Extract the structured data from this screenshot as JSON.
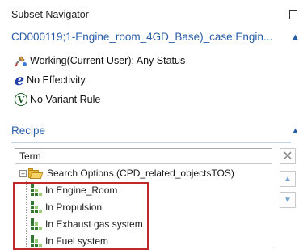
{
  "navigator": {
    "title": "Subset Navigator",
    "context_name": "CD000119;1-Engine_room_4GD_Base)_case:Engin...",
    "status": [
      {
        "icon": "working-status-icon",
        "text": "Working(Current User); Any Status"
      },
      {
        "icon": "effectivity-icon",
        "text": "No Effectivity",
        "glyph": "e"
      },
      {
        "icon": "variant-rule-icon",
        "text": "No Variant Rule",
        "glyph": "V"
      }
    ]
  },
  "recipe": {
    "title": "Recipe",
    "column_header": "Term",
    "rows": [
      {
        "label": "Search Options (CPD_related_objectsTOS)",
        "icon": "folder-icon",
        "expander": "+"
      },
      {
        "label": "In Engine_Room",
        "icon": "partition-icon"
      },
      {
        "label": "In Propulsion",
        "icon": "partition-icon"
      },
      {
        "label": "In Exhaust gas system",
        "icon": "partition-icon"
      },
      {
        "label": "In Fuel system",
        "icon": "partition-icon"
      }
    ]
  },
  "side_buttons": {
    "remove": "✕",
    "move_up": "▲",
    "move_down": "▼"
  },
  "icons": {
    "collapse": "▲"
  },
  "colors": {
    "link_blue": "#2a5da8",
    "highlight_red": "#c0282a",
    "variant_green": "#1d5a26",
    "effectivity_blue": "#1f3fa8"
  }
}
